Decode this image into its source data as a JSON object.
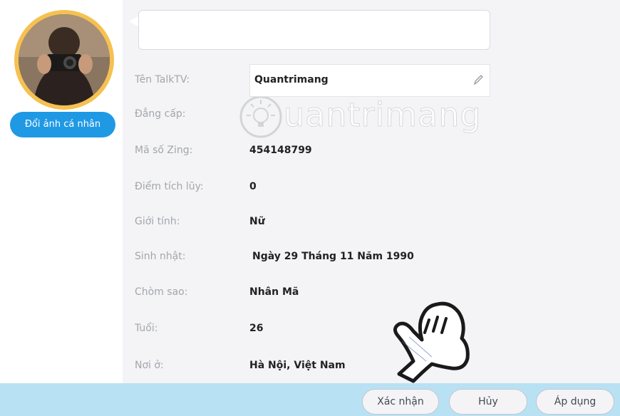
{
  "profile": {
    "change_avatar_label": "Đổi ảnh cá nhân",
    "status_text": ""
  },
  "watermark": {
    "text": "uantrimang"
  },
  "fields": {
    "talktv_label": "Tên TalkTV:",
    "talktv_value": "Quantrimang",
    "rank_label": "Đẳng cấp:",
    "rank_value": "",
    "zing_id_label": "Mã số Zing:",
    "zing_id_value": "454148799",
    "points_label": "Điểm tích lũy:",
    "points_value": "0",
    "gender_label": "Giới tính:",
    "gender_value": "Nữ",
    "birthday_label": "Sinh nhật:",
    "birthday_value": "Ngày 29 Tháng 11 Năm 1990",
    "zodiac_label": "Chòm sao:",
    "zodiac_value": "Nhân Mã",
    "age_label": "Tuổi:",
    "age_value": "26",
    "location_label": "Nơi ở:",
    "location_value": "Hà Nội, Việt Nam"
  },
  "actions": {
    "confirm_label": "Xác nhận",
    "cancel_label": "Hủy",
    "apply_label": "Áp dụng"
  },
  "colors": {
    "accent": "#2099e5",
    "avatar_ring": "#f6c150",
    "bottom_bar": "#b9e1f4"
  }
}
